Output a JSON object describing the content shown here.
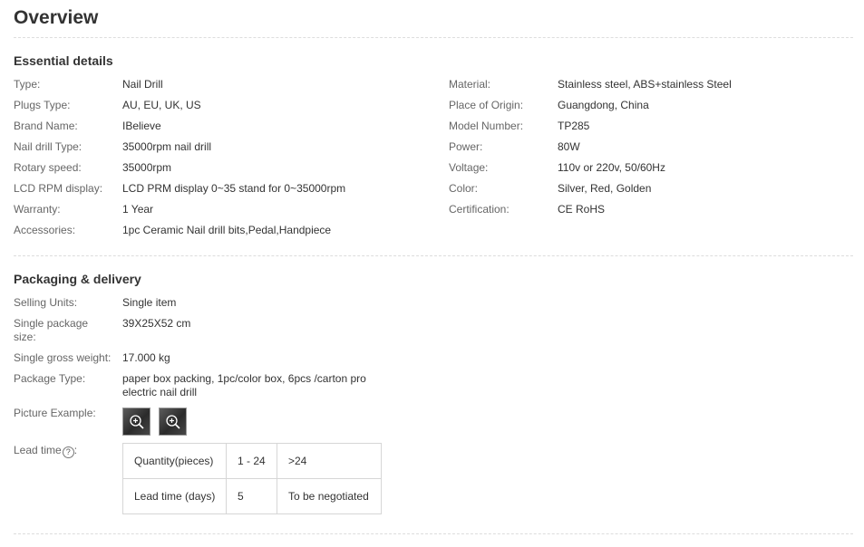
{
  "page": {
    "title": "Overview"
  },
  "essential": {
    "title": "Essential details",
    "left": [
      {
        "label": "Type:",
        "value": "Nail Drill"
      },
      {
        "label": "Plugs Type:",
        "value": "AU, EU, UK, US"
      },
      {
        "label": "Brand Name:",
        "value": "IBelieve"
      },
      {
        "label": "Nail drill Type:",
        "value": "35000rpm nail drill"
      },
      {
        "label": "Rotary speed:",
        "value": "35000rpm"
      },
      {
        "label": "LCD RPM display:",
        "value": "LCD PRM display 0~35 stand for 0~35000rpm"
      },
      {
        "label": "Warranty:",
        "value": "1 Year"
      },
      {
        "label": "Accessories:",
        "value": "1pc Ceramic Nail drill bits,Pedal,Handpiece"
      }
    ],
    "right": [
      {
        "label": "Material:",
        "value": "Stainless steel, ABS+stainless Steel"
      },
      {
        "label": "Place of Origin:",
        "value": "Guangdong, China"
      },
      {
        "label": "Model Number:",
        "value": "TP285"
      },
      {
        "label": "Power:",
        "value": "80W"
      },
      {
        "label": "Voltage:",
        "value": "110v or 220v, 50/60Hz"
      },
      {
        "label": "Color:",
        "value": "Silver, Red, Golden"
      },
      {
        "label": "Certification:",
        "value": "CE RoHS"
      }
    ]
  },
  "packaging": {
    "title": "Packaging & delivery",
    "selling_units": {
      "label": "Selling Units:",
      "value": "Single item"
    },
    "package_size": {
      "label": "Single package size:",
      "value": "39X25X52 cm"
    },
    "gross_weight": {
      "label": "Single gross weight:",
      "value": "17.000 kg"
    },
    "package_type": {
      "label": "Package Type:",
      "value": "paper box packing, 1pc/color box, 6pcs /carton pro electric nail drill"
    },
    "picture_example": {
      "label": "Picture Example:",
      "thumb_icon": "zoom-in-icon"
    },
    "lead_time": {
      "label": "Lead time",
      "help_icon": "?",
      "table": {
        "row1": [
          "Quantity(pieces)",
          "1 - 24",
          ">24"
        ],
        "row2": [
          "Lead time (days)",
          "5",
          "To be negotiated"
        ]
      }
    }
  }
}
